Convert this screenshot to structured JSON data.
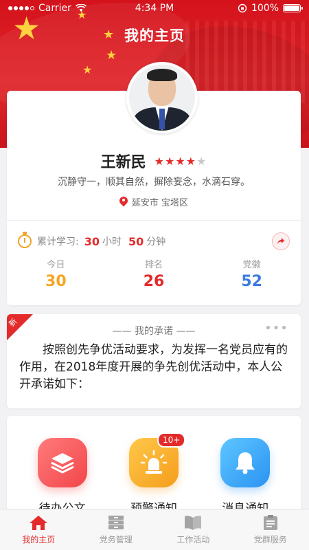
{
  "status_bar": {
    "carrier": "Carrier",
    "time": "4:34 PM",
    "battery": "100%"
  },
  "header": {
    "title": "我的主页"
  },
  "profile": {
    "name": "王新民",
    "rating": 4,
    "rating_max": 5,
    "motto": "沉静守一，顺其自然，摒除妄念，水滴石穿。",
    "location": "延安市 宝塔区"
  },
  "study": {
    "label": "累计学习:",
    "hours": "30",
    "hours_unit": "小时",
    "minutes": "50",
    "minutes_unit": "分钟"
  },
  "stats": [
    {
      "label": "今日",
      "value": "30",
      "color": "#f5a623"
    },
    {
      "label": "排名",
      "value": "26",
      "color": "#e32b2b"
    },
    {
      "label": "党徽",
      "value": "52",
      "color": "#3d7be0"
    }
  ],
  "promise": {
    "ribbon": "新",
    "title": "—— 我的承诺 ——",
    "more": "•••",
    "body": "按照创先争优活动要求，为发挥一名党员应有的作用，在2018年度开展的争先创优活动中，本人公开承诺如下："
  },
  "services": [
    {
      "label": "待办公文",
      "icon": "stack-layers-icon"
    },
    {
      "label": "预警通知",
      "icon": "alarm-light-icon",
      "badge": "10+"
    },
    {
      "label": "消息通知",
      "icon": "bell-icon"
    }
  ],
  "tabs": [
    {
      "label": "我的主页",
      "icon": "home-icon",
      "active": true
    },
    {
      "label": "党务管理",
      "icon": "cabinet-icon",
      "active": false
    },
    {
      "label": "工作活动",
      "icon": "book-icon",
      "active": false
    },
    {
      "label": "党群服务",
      "icon": "clipboard-icon",
      "active": false
    }
  ],
  "colors": {
    "primary": "#e32b2b",
    "orange": "#f5a623",
    "blue": "#3d7be0"
  }
}
